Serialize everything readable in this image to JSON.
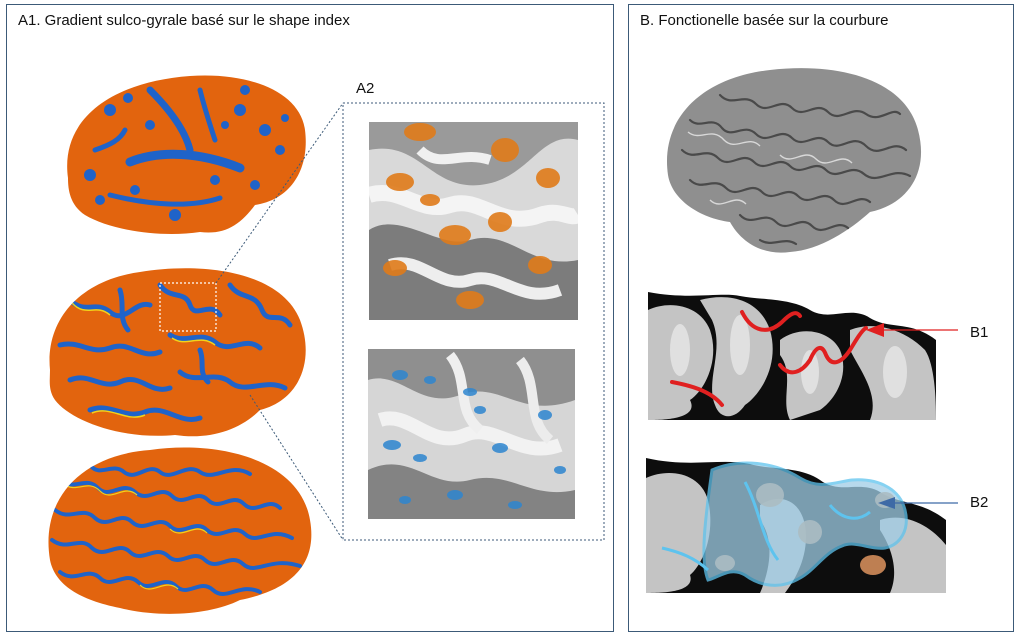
{
  "panel_a": {
    "title": "A1. Gradient sulco-gyrale basé sur le shape index",
    "inset_label": "A2"
  },
  "panel_b": {
    "title": "B. Fonctionelle basée sur la courbure",
    "label_b1": "B1",
    "label_b2": "B2"
  },
  "colors": {
    "frame": "#3c5a78",
    "gyral_orange": "#e2640e",
    "sulcal_blue": "#1f63c9",
    "highlight_red": "#e02020",
    "highlight_blue": "#5ec3ee",
    "gray_surface": "#8f8f8f"
  }
}
